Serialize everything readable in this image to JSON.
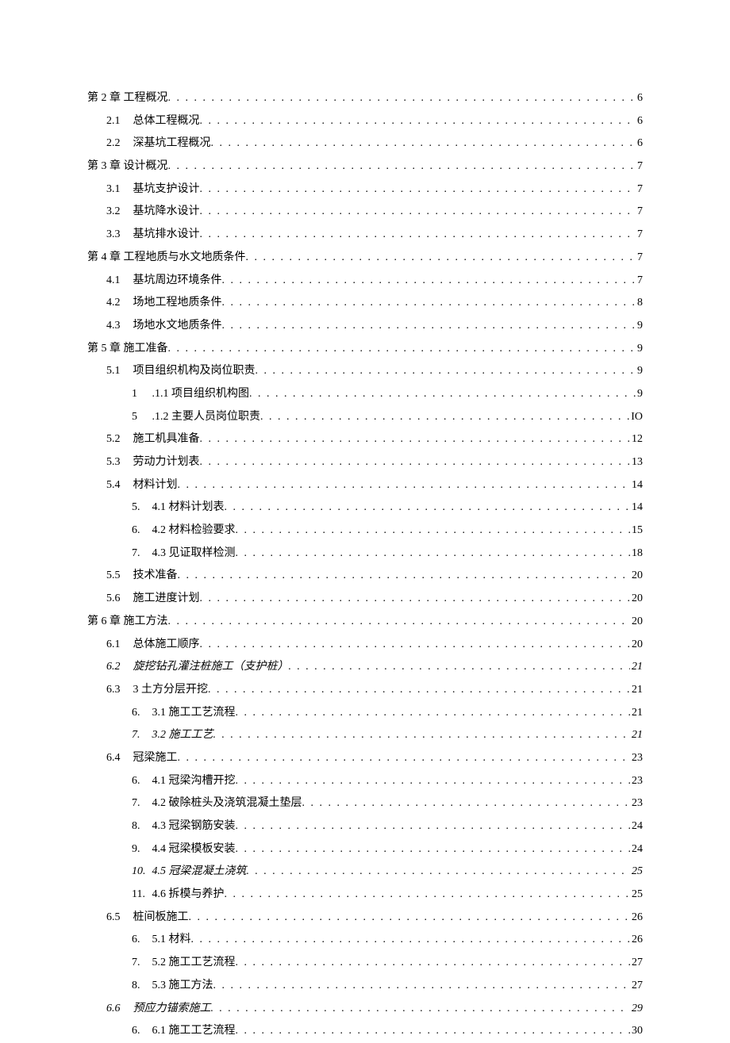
{
  "toc": [
    {
      "level": 1,
      "label": "第 2 章 工程概况",
      "page": "6"
    },
    {
      "level": 2,
      "num": "2.1",
      "label": "总体工程概况",
      "page": "6"
    },
    {
      "level": 2,
      "num": "2.2",
      "label": "深基坑工程概况",
      "page": "6"
    },
    {
      "level": 1,
      "label": "第 3 章 设计概况",
      "page": "7"
    },
    {
      "level": 2,
      "num": "3.1",
      "label": "基坑支护设计",
      "page": "7"
    },
    {
      "level": 2,
      "num": "3.2",
      "label": "基坑降水设计",
      "page": "7"
    },
    {
      "level": 2,
      "num": "3.3",
      "label": "基坑排水设计",
      "page": "7"
    },
    {
      "level": 1,
      "label": "第 4 章 工程地质与水文地质条件",
      "page": "7"
    },
    {
      "level": 2,
      "num": "4.1",
      "label": "基坑周边环境条件",
      "page": "7"
    },
    {
      "level": 2,
      "num": "4.2",
      "label": "场地工程地质条件",
      "page": "8"
    },
    {
      "level": 2,
      "num": "4.3",
      "label": "场地水文地质条件",
      "page": "9"
    },
    {
      "level": 1,
      "label": "第 5 章 施工准备",
      "page": "9"
    },
    {
      "level": 2,
      "num": "5.1",
      "label": "项目组织机构及岗位职责",
      "page": "9"
    },
    {
      "level": 3,
      "num": "1",
      "label": ".1.1 项目组织机构图",
      "page": "9"
    },
    {
      "level": 3,
      "num": "5",
      "label": ".1.2 主要人员岗位职责",
      "page": "IO"
    },
    {
      "level": 2,
      "num": "5.2",
      "label": "施工机具准备",
      "page": "12"
    },
    {
      "level": 2,
      "num": "5.3",
      "label": "劳动力计划表",
      "page": "13"
    },
    {
      "level": 2,
      "num": "5.4",
      "label": "材料计划",
      "page": "14"
    },
    {
      "level": 3,
      "num": "5.",
      "label": "4.1 材料计划表",
      "page": "14"
    },
    {
      "level": 3,
      "num": "6.",
      "label": "4.2 材料检验要求",
      "page": "15"
    },
    {
      "level": 3,
      "num": "7.",
      "label": "4.3 见证取样检测",
      "page": "18"
    },
    {
      "level": 2,
      "num": "5.5",
      "label": "技术准备",
      "page": "20"
    },
    {
      "level": 2,
      "num": "5.6",
      "label": "施工进度计划",
      "page": "20"
    },
    {
      "level": 1,
      "label": "第 6 章 施工方法",
      "page": "20"
    },
    {
      "level": 2,
      "num": "6.1",
      "label": "总体施工顺序",
      "page": "20"
    },
    {
      "level": 2,
      "num": "6.2",
      "label": "旋挖钻孔灌注桩施工（支护桩）",
      "page": "21",
      "italic": true
    },
    {
      "level": 2,
      "num": "6.3",
      "label": "3 土方分层开挖",
      "page": "21"
    },
    {
      "level": 3,
      "num": "6.",
      "label": "3.1 施工工艺流程",
      "page": "21"
    },
    {
      "level": 3,
      "num": "7.",
      "label": "3.2 施工工艺",
      "page": "21",
      "italic": true
    },
    {
      "level": 2,
      "num": "6.4",
      "label": "冠梁施工",
      "page": "23"
    },
    {
      "level": 3,
      "num": "6.",
      "label": "4.1 冠梁沟槽开挖",
      "page": "23"
    },
    {
      "level": 3,
      "num": "7.",
      "label": "4.2 破除桩头及浇筑混凝土垫层",
      "page": "23"
    },
    {
      "level": 3,
      "num": "8.",
      "label": "4.3 冠梁钢筋安装",
      "page": "24"
    },
    {
      "level": 3,
      "num": "9.",
      "label": "4.4 冠梁模板安装",
      "page": "24"
    },
    {
      "level": 3,
      "num": "10.",
      "label": "4.5 冠梁混凝土浇筑",
      "page": "25",
      "italic": true
    },
    {
      "level": 3,
      "num": "11.",
      "label": "4.6 拆模与养护",
      "page": "25"
    },
    {
      "level": 2,
      "num": "6.5",
      "label": "桩间板施工",
      "page": "26"
    },
    {
      "level": 3,
      "num": "6.",
      "label": "5.1 材料",
      "page": "26"
    },
    {
      "level": 3,
      "num": "7.",
      "label": "5.2 施工工艺流程",
      "page": "27"
    },
    {
      "level": 3,
      "num": "8.",
      "label": "5.3 施工方法",
      "page": "27"
    },
    {
      "level": 2,
      "num": "6.6",
      "label": "预应力锚索施工",
      "page": "29",
      "italic": true
    },
    {
      "level": 3,
      "num": "6.",
      "label": "6.1 施工工艺流程",
      "page": "30"
    }
  ]
}
